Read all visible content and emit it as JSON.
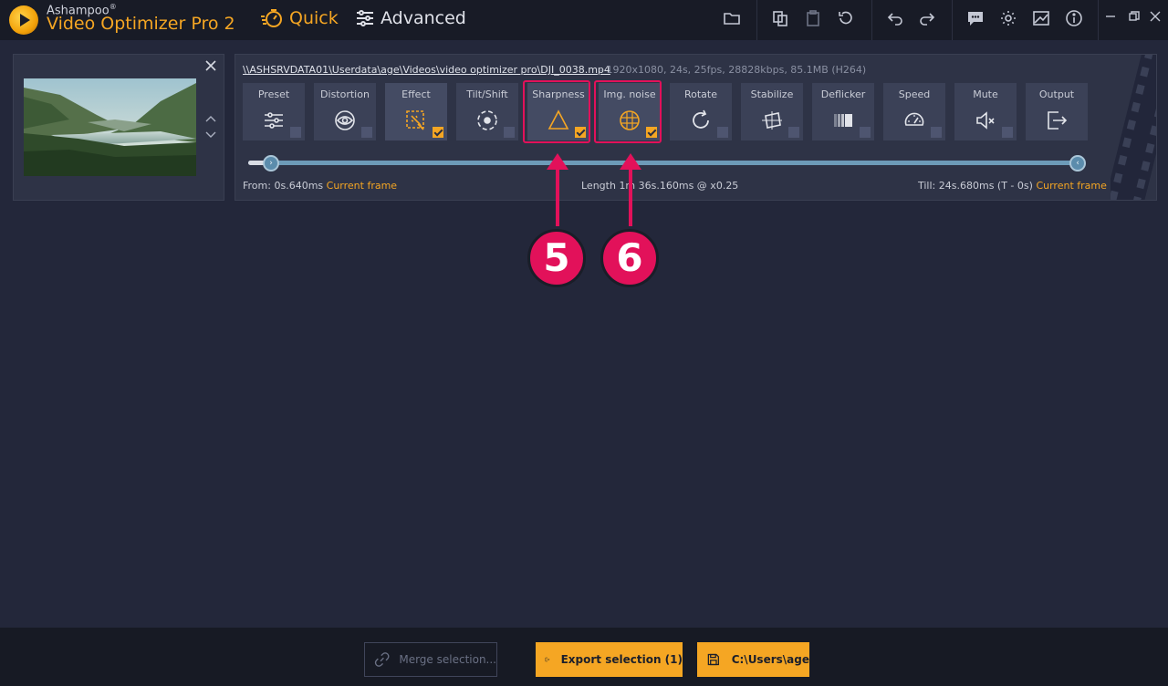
{
  "app": {
    "brand_small": "Ashampoo",
    "brand_sup": "®",
    "brand_name": "Video Optimizer Pro 2"
  },
  "modes": {
    "quick": "Quick",
    "advanced": "Advanced"
  },
  "file": {
    "path": "\\\\ASHSRVDATA01\\Userdata\\age\\Videos\\video optimizer pro\\DJI_0038.mp4",
    "meta": "-   1920x1080, 24s, 25fps, 28828kbps, 85.1MB (H264)"
  },
  "tools": [
    {
      "label": "Preset",
      "icon": "sliders-icon",
      "checked": false
    },
    {
      "label": "Distortion",
      "icon": "eye-lens-icon",
      "checked": false
    },
    {
      "label": "Effect",
      "icon": "magic-frame-icon",
      "checked": true
    },
    {
      "label": "Tilt/Shift",
      "icon": "focus-circle-icon",
      "checked": false
    },
    {
      "label": "Sharpness",
      "icon": "triangle-icon",
      "checked": true
    },
    {
      "label": "Img. noise",
      "icon": "noise-grid-icon",
      "checked": true
    },
    {
      "label": "Rotate",
      "icon": "rotate-icon",
      "checked": false
    },
    {
      "label": "Stabilize",
      "icon": "stabilize-icon",
      "checked": false
    },
    {
      "label": "Deflicker",
      "icon": "deflicker-icon",
      "checked": false
    },
    {
      "label": "Speed",
      "icon": "speedometer-icon",
      "checked": false
    },
    {
      "label": "Mute",
      "icon": "speaker-mute-icon",
      "checked": false
    },
    {
      "label": "Output",
      "icon": "output-icon",
      "checked": false
    }
  ],
  "timeline": {
    "from_label": "From:",
    "from_value": "0s.640ms",
    "current_frame": "Current frame",
    "length_text": "Length  1m 36s.160ms @ x0.25",
    "till_label": "Till:",
    "till_value": "24s.680ms (T - 0s)"
  },
  "callouts": {
    "first": "5",
    "second": "6"
  },
  "bottom": {
    "merge": "Merge selection...",
    "export": "Export selection (1)",
    "save_path": "C:\\Users\\age"
  },
  "colors": {
    "accent": "#f5a623",
    "callout": "#e2115a",
    "background": "#23273a"
  }
}
